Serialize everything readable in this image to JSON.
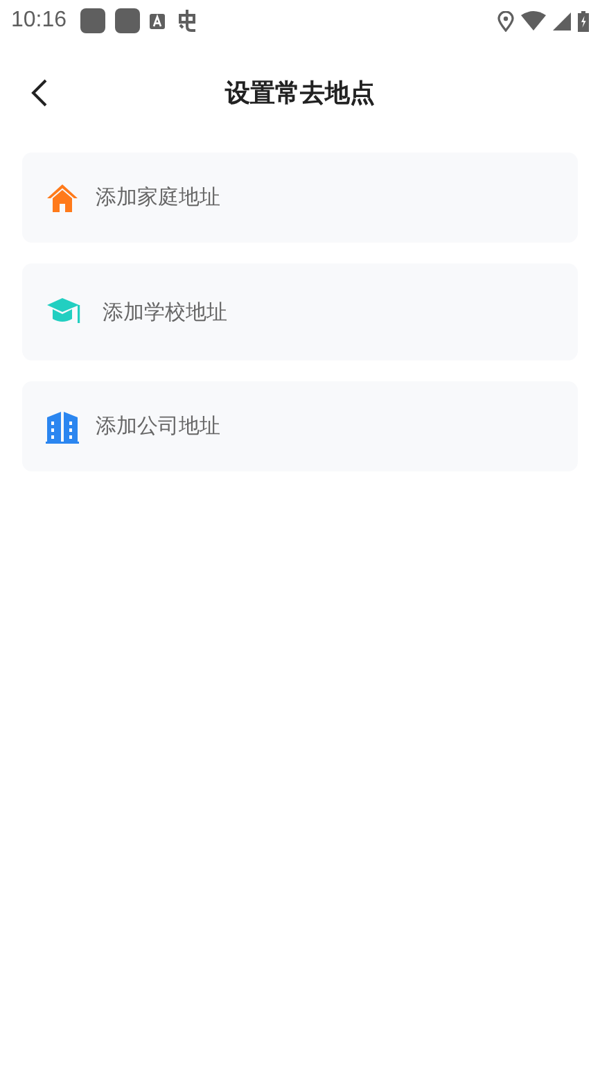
{
  "status_bar": {
    "time": "10:16"
  },
  "header": {
    "title": "设置常去地点"
  },
  "places": [
    {
      "kind": "home",
      "label": "添加家庭地址"
    },
    {
      "kind": "school",
      "label": "添加学校地址"
    },
    {
      "kind": "company",
      "label": "添加公司地址"
    }
  ]
}
